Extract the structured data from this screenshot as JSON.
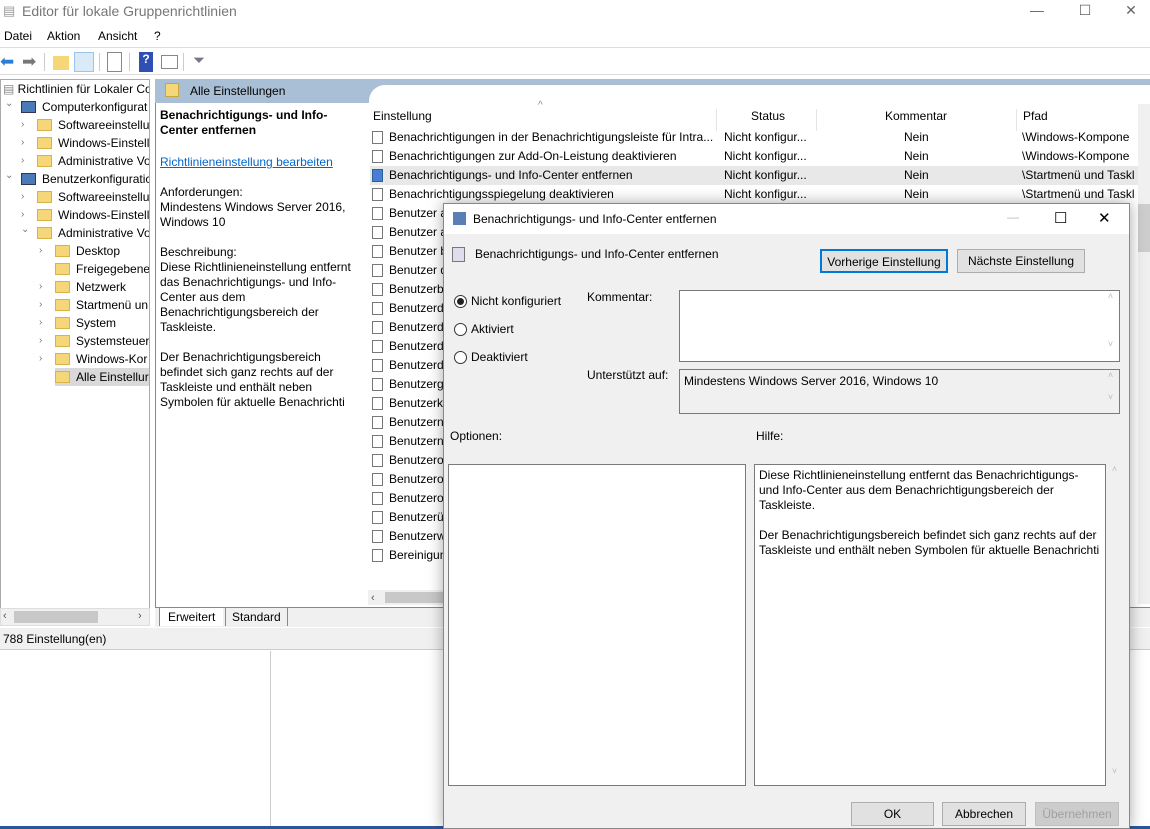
{
  "window": {
    "title": "Editor für lokale Gruppenrichtlinien",
    "controls": {
      "minimize": "—",
      "maximize": "☐",
      "close": "✕"
    }
  },
  "menu": [
    "Datei",
    "Aktion",
    "Ansicht",
    "?"
  ],
  "toolbar": {
    "icons": [
      "back-arrow-icon",
      "forward-arrow-icon",
      "up-folder-icon",
      "show-hide-tree-icon",
      "export-list-icon",
      "help-icon",
      "properties-pane-icon",
      "filter-icon"
    ]
  },
  "tree": {
    "root": "Richtlinien für Lokaler Co",
    "items": [
      {
        "label": "Computerkonfigurat",
        "level": 0,
        "expanded": true
      },
      {
        "label": "Softwareeinstellu",
        "level": 1
      },
      {
        "label": "Windows-Einstell",
        "level": 1
      },
      {
        "label": "Administrative Vo",
        "level": 1
      },
      {
        "label": "Benutzerkonfiguratic",
        "level": 0,
        "expanded": true
      },
      {
        "label": "Softwareeinstellu",
        "level": 1
      },
      {
        "label": "Windows-Einstell",
        "level": 1
      },
      {
        "label": "Administrative Vo",
        "level": 1,
        "expanded": true
      },
      {
        "label": "Desktop",
        "level": 2
      },
      {
        "label": "Freigegebene",
        "level": 2,
        "nochev": true
      },
      {
        "label": "Netzwerk",
        "level": 2
      },
      {
        "label": "Startmenü un",
        "level": 2
      },
      {
        "label": "System",
        "level": 2
      },
      {
        "label": "Systemsteuer",
        "level": 2
      },
      {
        "label": "Windows-Kor",
        "level": 2
      },
      {
        "label": "Alle Einstellur",
        "level": 2,
        "nochev": true,
        "selected": true
      }
    ]
  },
  "center": {
    "header": "Alle Einstellungen",
    "desc_title": "Benachrichtigungs- und Info-Center entfernen",
    "edit_link": "Richtlinieneinstellung bearbeiten",
    "req_label": "Anforderungen:",
    "req_value": "Mindestens Windows Server 2016, Windows 10",
    "desc_label": "Beschreibung:",
    "desc_p1": "Diese Richtlinieneinstellung entfernt das Benachrichtigungs- und Info-Center aus dem Benachrichtigungsbereich der Taskleiste.",
    "desc_p2": "Der Benachrichtigungsbereich befindet sich ganz rechts auf der Taskleiste und enthält neben Symbolen für aktuelle Benachrichti"
  },
  "list": {
    "columns": [
      "Einstellung",
      "Status",
      "Kommentar",
      "Pfad"
    ],
    "rows": [
      [
        "Benachrichtigungen in der Benachrichtigungsleiste für Intra...",
        "Nicht konfigur...",
        "Nein",
        "\\Windows-Kompone"
      ],
      [
        "Benachrichtigungen zur Add-On-Leistung deaktivieren",
        "Nicht konfigur...",
        "Nein",
        "\\Windows-Kompone"
      ],
      [
        "Benachrichtigungs- und Info-Center entfernen",
        "Nicht konfigur...",
        "Nein",
        "\\Startmenü und Taskl"
      ],
      [
        "Benachrichtigungsspiegelung deaktivieren",
        "Nicht konfigur...",
        "Nein",
        "\\Startmenü und Taskl"
      ],
      [
        "Benutzer a",
        "",
        "",
        "kl"
      ],
      [
        "Benutzer a",
        "",
        "",
        "e"
      ],
      [
        "Benutzer b",
        "",
        "",
        "e"
      ],
      [
        "Benutzer d",
        "",
        "",
        "e"
      ],
      [
        "Benutzerb",
        "",
        "",
        "e"
      ],
      [
        "Benutzerd",
        "",
        "",
        "ec"
      ],
      [
        "Benutzerd",
        "",
        "",
        "ec"
      ],
      [
        "Benutzerd",
        "",
        "",
        "e"
      ],
      [
        "Benutzerd",
        "",
        "",
        "e"
      ],
      [
        "Benutzerg",
        "",
        "",
        "e"
      ],
      [
        "Benutzerk",
        "",
        "",
        "t"
      ],
      [
        "Benutzern",
        "",
        "",
        "e"
      ],
      [
        "Benutzern",
        "",
        "",
        "kl"
      ],
      [
        "Benutzero",
        "",
        "",
        "e"
      ],
      [
        "Benutzero",
        "",
        "",
        "e"
      ],
      [
        "Benutzero",
        "",
        "",
        "kl"
      ],
      [
        "Benutzerü",
        "",
        "",
        "kl"
      ],
      [
        "Benutzerw",
        "",
        "",
        "e"
      ],
      [
        "Bereinigun",
        "",
        "",
        "kl"
      ]
    ],
    "selected_index": 2
  },
  "tabs": [
    "Erweitert",
    "Standard"
  ],
  "status": "788 Einstellung(en)",
  "dialog": {
    "title": "Benachrichtigungs- und Info-Center entfernen",
    "setting_name": "Benachrichtigungs- und Info-Center entfernen",
    "prev": "Vorherige Einstellung",
    "next": "Nächste Einstellung",
    "radios": [
      "Nicht konfiguriert",
      "Aktiviert",
      "Deaktiviert"
    ],
    "selected_radio": 0,
    "comment_label": "Kommentar:",
    "comment_value": "",
    "supported_label": "Unterstützt auf:",
    "supported_value": "Mindestens Windows Server 2016, Windows 10",
    "options_label": "Optionen:",
    "help_label": "Hilfe:",
    "help_p1": "Diese Richtlinieneinstellung entfernt das Benachrichtigungs- und Info-Center aus dem Benachrichtigungsbereich der Taskleiste.",
    "help_p2": "Der Benachrichtigungsbereich befindet sich ganz rechts auf der Taskleiste und enthält neben Symbolen für aktuelle Benachrichti",
    "ok": "OK",
    "cancel": "Abbrechen",
    "apply": "Übernehmen"
  },
  "colors": {
    "accent": "#0078d7",
    "link": "#0066cc",
    "header_band": "#a9bfd6",
    "selected_row": "#e8e8e8"
  }
}
